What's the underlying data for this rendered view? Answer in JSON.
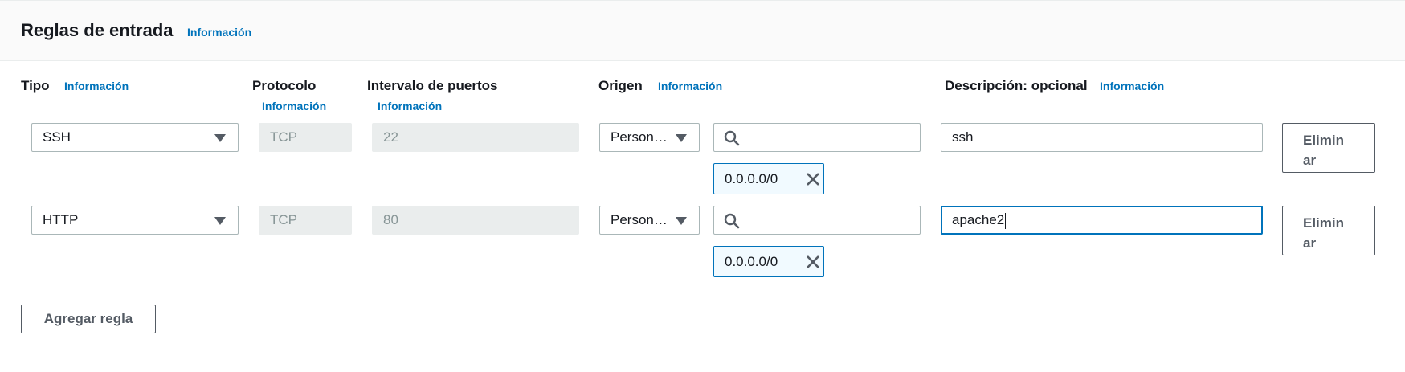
{
  "header": {
    "title": "Reglas de entrada",
    "info_link": "Información"
  },
  "columns": {
    "tipo": "Tipo",
    "tipo_info": "Información",
    "protocolo": "Protocolo",
    "protocolo_info": "Información",
    "intervalo": "Intervalo de puertos",
    "intervalo_info": "Información",
    "origen": "Origen",
    "origen_info": "Información",
    "descripcion": "Descripción: opcional",
    "descripcion_info": "Información"
  },
  "rules": [
    {
      "type": "SSH",
      "protocol": "TCP",
      "port_range": "22",
      "source_type": "Person…",
      "source_search": "",
      "source_token": "0.0.0.0/0",
      "description": "ssh",
      "delete_label_1": "Elimin",
      "delete_label_2": "ar"
    },
    {
      "type": "HTTP",
      "protocol": "TCP",
      "port_range": "80",
      "source_type": "Person…",
      "source_search": "",
      "source_token": "0.0.0.0/0",
      "description": "apache2",
      "delete_label_1": "Elimin",
      "delete_label_2": "ar"
    }
  ],
  "add_rule_label": "Agregar regla",
  "icons": [
    "search-icon",
    "chevron-down-icon",
    "close-icon"
  ],
  "colors": {
    "link": "#0073bb",
    "token_bg": "#f1faff",
    "disabled_bg": "#eaeded"
  }
}
